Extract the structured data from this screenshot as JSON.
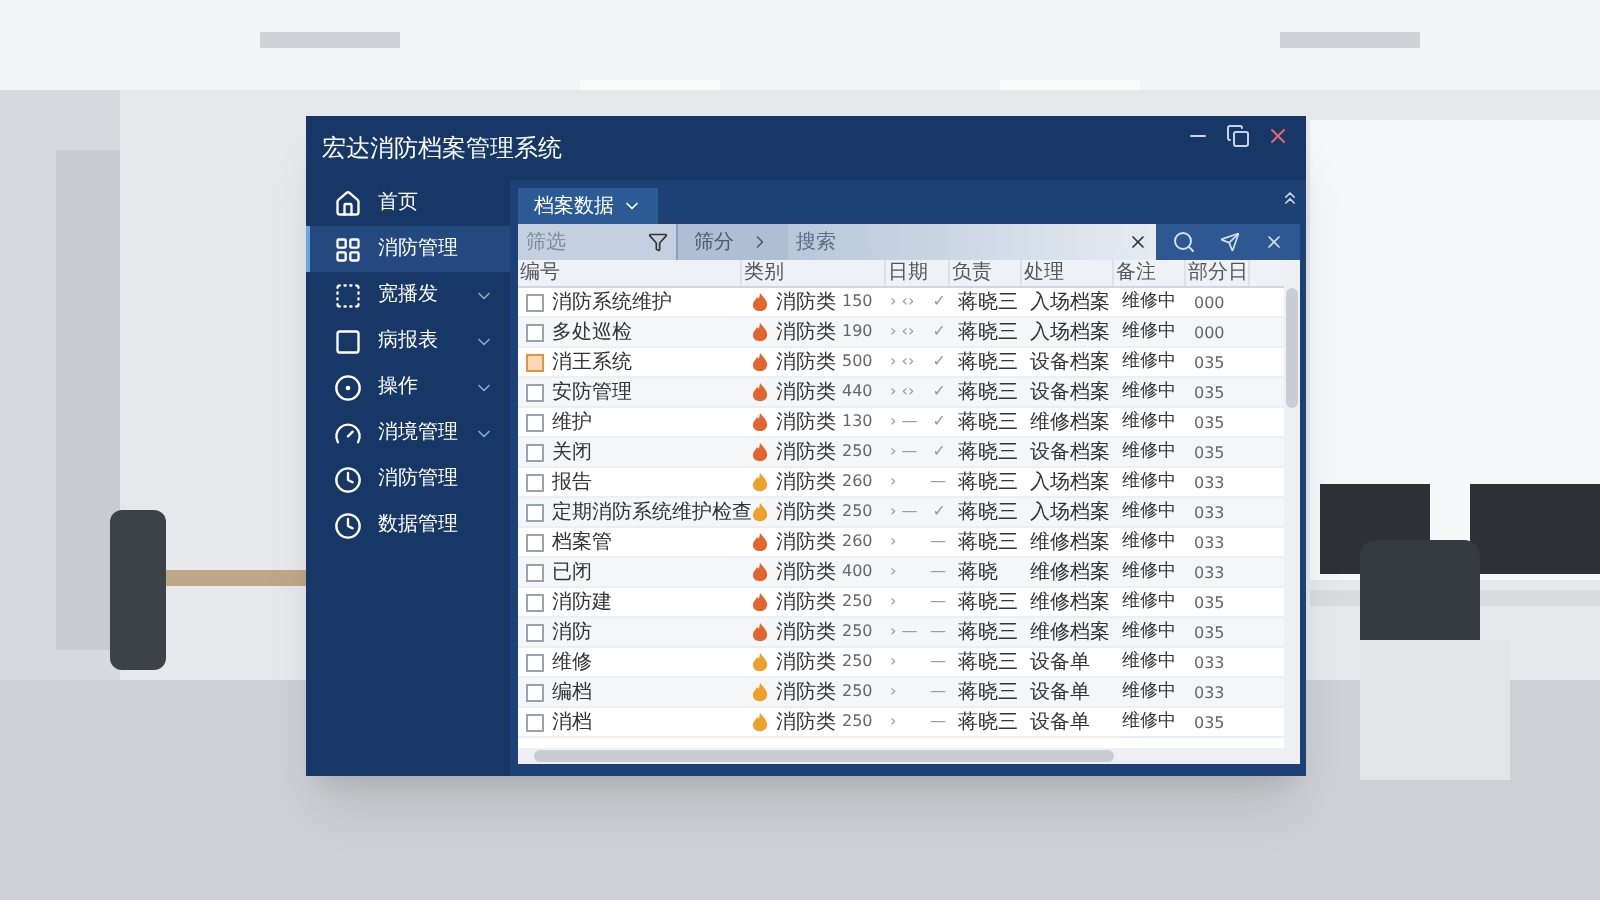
{
  "window": {
    "title": "宏达消防档案管理系统"
  },
  "sidebar": {
    "items": [
      {
        "label": "首页",
        "selected": false,
        "expandable": false
      },
      {
        "label": "消防管理",
        "selected": true,
        "expandable": false
      },
      {
        "label": "宽播发",
        "selected": false,
        "expandable": true
      },
      {
        "label": "病报表",
        "selected": false,
        "expandable": true
      },
      {
        "label": "操作",
        "selected": false,
        "expandable": true
      },
      {
        "label": "消境管理",
        "selected": false,
        "expandable": true
      },
      {
        "label": "消防管理",
        "selected": false,
        "expandable": false
      },
      {
        "label": "数据管理",
        "selected": false,
        "expandable": false
      }
    ]
  },
  "tabs": [
    {
      "label": "档案数据",
      "selected": true
    }
  ],
  "filter": {
    "filter_placeholder": "筛选",
    "group_button": "筛分",
    "search_placeholder": "搜索"
  },
  "table": {
    "columns": [
      "编号",
      "类别",
      "日期",
      "负责",
      "处理",
      "备注",
      "部分日"
    ],
    "rows": [
      {
        "name": "消防系统维护",
        "checked": false,
        "focused": false,
        "color": "#e2652e",
        "category": "消防类",
        "amount": "150",
        "date": "› ‹›",
        "flag": "✓",
        "owner": "蒋晓三",
        "process": "入场档案",
        "note": "维修中",
        "code": "000"
      },
      {
        "name": "多处巡检",
        "checked": false,
        "focused": false,
        "color": "#e2652e",
        "category": "消防类",
        "amount": "190",
        "date": "› ‹›",
        "flag": "✓",
        "owner": "蒋晓三",
        "process": "入场档案",
        "note": "维修中",
        "code": "000"
      },
      {
        "name": "消王系统",
        "checked": false,
        "focused": true,
        "color": "#e2652e",
        "category": "消防类",
        "amount": "500",
        "date": "› ‹›",
        "flag": "✓",
        "owner": "蒋晓三",
        "process": "设备档案",
        "note": "维修中",
        "code": "035"
      },
      {
        "name": "安防管理",
        "checked": false,
        "focused": false,
        "color": "#e2652e",
        "category": "消防类",
        "amount": "440",
        "date": "› ‹›",
        "flag": "✓",
        "owner": "蒋晓三",
        "process": "设备档案",
        "note": "维修中",
        "code": "035"
      },
      {
        "name": "维护",
        "checked": false,
        "focused": false,
        "color": "#e2652e",
        "category": "消防类",
        "amount": "130",
        "date": "› —",
        "flag": "✓",
        "owner": "蒋晓三",
        "process": "维修档案",
        "note": "维修中",
        "code": "035"
      },
      {
        "name": "关闭",
        "checked": false,
        "focused": false,
        "color": "#e2652e",
        "category": "消防类",
        "amount": "250",
        "date": "› —",
        "flag": "✓",
        "owner": "蒋晓三",
        "process": "设备档案",
        "note": "维修中",
        "code": "035"
      },
      {
        "name": "报告",
        "checked": false,
        "focused": false,
        "color": "#eea028",
        "category": "消防类",
        "amount": "260",
        "date": "›",
        "flag": "—",
        "owner": "蒋晓三",
        "process": "入场档案",
        "note": "维修中",
        "code": "033"
      },
      {
        "name": "定期消防系统维护检查",
        "checked": false,
        "focused": false,
        "color": "#eea028",
        "category": "消防类",
        "amount": "250",
        "date": "› —",
        "flag": "✓",
        "owner": "蒋晓三",
        "process": "入场档案",
        "note": "维修中",
        "code": "033"
      },
      {
        "name": "档案管",
        "checked": false,
        "focused": false,
        "color": "#e2652e",
        "category": "消防类",
        "amount": "260",
        "date": "›",
        "flag": "—",
        "owner": "蒋晓三",
        "process": "维修档案",
        "note": "维修中",
        "code": "033"
      },
      {
        "name": "已闭",
        "checked": false,
        "focused": false,
        "color": "#e2652e",
        "category": "消防类",
        "amount": "400",
        "date": "›",
        "flag": "—",
        "owner": "蒋晓",
        "process": "维修档案",
        "note": "维修中",
        "code": "033"
      },
      {
        "name": "消防建",
        "checked": false,
        "focused": false,
        "color": "#e2652e",
        "category": "消防类",
        "amount": "250",
        "date": "›",
        "flag": "—",
        "owner": "蒋晓三",
        "process": "维修档案",
        "note": "维修中",
        "code": "035"
      },
      {
        "name": "消防",
        "checked": false,
        "focused": false,
        "color": "#e2652e",
        "category": "消防类",
        "amount": "250",
        "date": "› —",
        "flag": "—",
        "owner": "蒋晓三",
        "process": "维修档案",
        "note": "维修中",
        "code": "035"
      },
      {
        "name": "维修",
        "checked": false,
        "focused": false,
        "color": "#eea028",
        "category": "消防类",
        "amount": "250",
        "date": "›",
        "flag": "—",
        "owner": "蒋晓三",
        "process": "设备单",
        "note": "维修中",
        "code": "033"
      },
      {
        "name": "编档",
        "checked": false,
        "focused": false,
        "color": "#eea028",
        "category": "消防类",
        "amount": "250",
        "date": "›",
        "flag": "—",
        "owner": "蒋晓三",
        "process": "设备单",
        "note": "维修中",
        "code": "033"
      },
      {
        "name": "消档",
        "checked": false,
        "focused": false,
        "color": "#eea028",
        "category": "消防类",
        "amount": "250",
        "date": "›",
        "flag": "—",
        "owner": "蒋晓三",
        "process": "设备单",
        "note": "维修中",
        "code": "035"
      }
    ]
  }
}
